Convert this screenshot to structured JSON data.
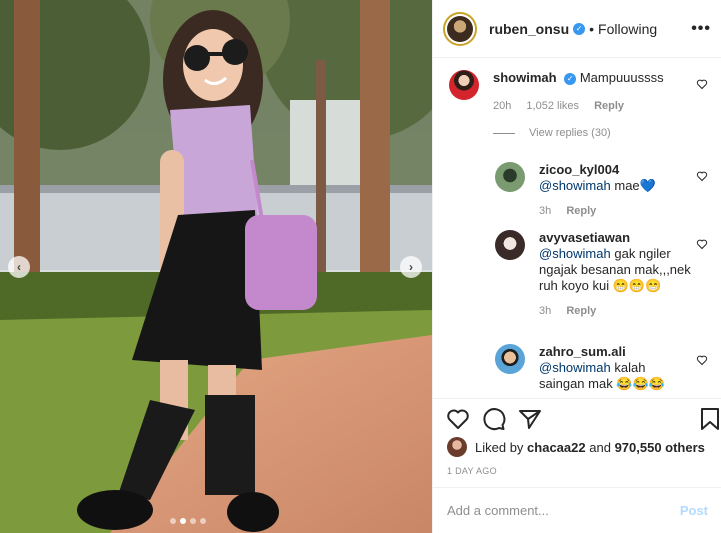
{
  "header": {
    "username": "ruben_onsu",
    "follow_status": "Following",
    "separator": "•"
  },
  "photo": {
    "dots": 4,
    "active_dot": 2
  },
  "comments": [
    {
      "username": "showimah",
      "verified": true,
      "mention": "",
      "text": "Mampuuussss",
      "time": "20h",
      "likes": "1,052 likes",
      "reply": "Reply"
    },
    {
      "username": "zicoo_kyl004",
      "verified": false,
      "mention": "@showimah",
      "text": "mae💙",
      "time": "3h",
      "likes": "",
      "reply": "Reply"
    },
    {
      "username": "avyvasetiawan",
      "verified": false,
      "mention": "@showimah",
      "text": "gak ngiler ngajak besanan mak,,,nek ruh koyo kui 😁😁😁",
      "time": "3h",
      "likes": "",
      "reply": "Reply"
    },
    {
      "username": "zahro_sum.ali",
      "verified": false,
      "mention": "@showimah",
      "text": "kalah saingan mak 😂😂😂",
      "time": "",
      "likes": "",
      "reply": ""
    }
  ],
  "view_replies": "View replies (30)",
  "likes_line": {
    "prefix": "Liked by",
    "user": "chacaa22",
    "middle": "and",
    "count": "970,550 others"
  },
  "timestamp": "1 DAY AGO",
  "add_comment": {
    "placeholder": "Add a comment...",
    "post_label": "Post"
  },
  "colors": {
    "verified": "#3897f0",
    "mention": "#00376b",
    "post_disabled": "#b3dbff",
    "meta": "#8e8e8e"
  }
}
